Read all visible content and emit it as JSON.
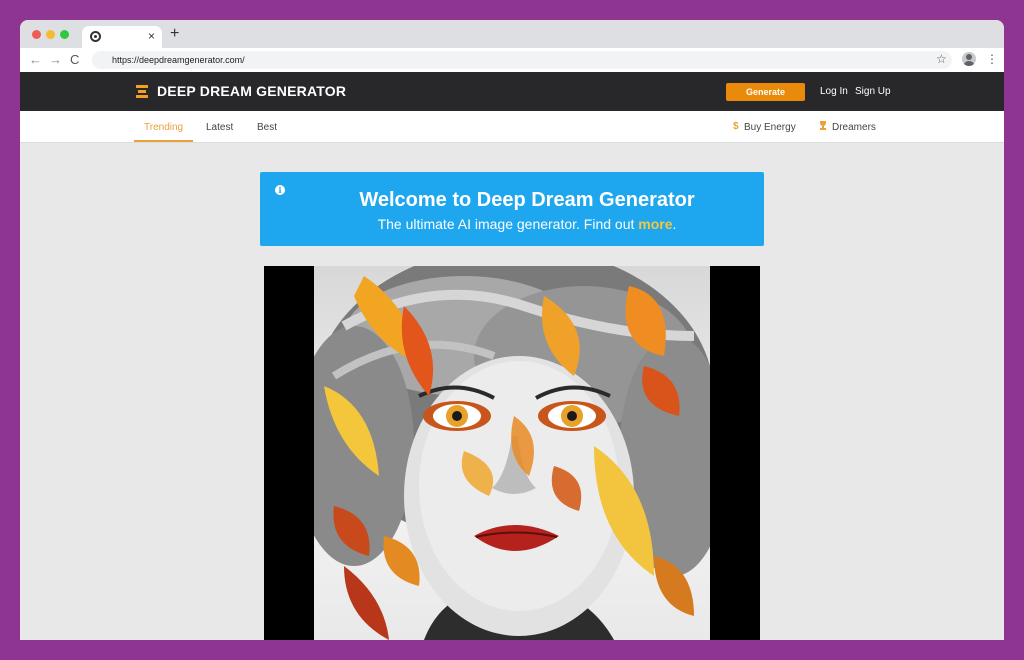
{
  "browser": {
    "tab_close": "×",
    "new_tab": "+",
    "url": "https://deepdreamgenerator.com/",
    "nav": {
      "back": "←",
      "forward": "→",
      "reload": "C"
    },
    "star": "☆",
    "menu": "⋮"
  },
  "header": {
    "logo_text": "DEEP DREAM GENERATOR",
    "generate_label": "Generate",
    "login_label": "Log In",
    "signup_label": "Sign Up"
  },
  "subnav": {
    "tabs": [
      {
        "label": "Trending",
        "active": true
      },
      {
        "label": "Latest",
        "active": false
      },
      {
        "label": "Best",
        "active": false
      }
    ],
    "energy_icon": "$",
    "energy_label": "Buy Energy",
    "dreamers_label": "Dreamers"
  },
  "banner": {
    "info_icon": "i",
    "title": "Welcome to Deep Dream Generator",
    "subtitle_prefix": "The ultimate AI image generator. Find out ",
    "subtitle_link": "more",
    "subtitle_suffix": "."
  },
  "colors": {
    "accent": "#ea8a0a",
    "header_bg": "#28282b",
    "banner_bg": "#1ea7ee",
    "link_highlight": "#f4c543",
    "frame_bg": "#8e3592"
  }
}
